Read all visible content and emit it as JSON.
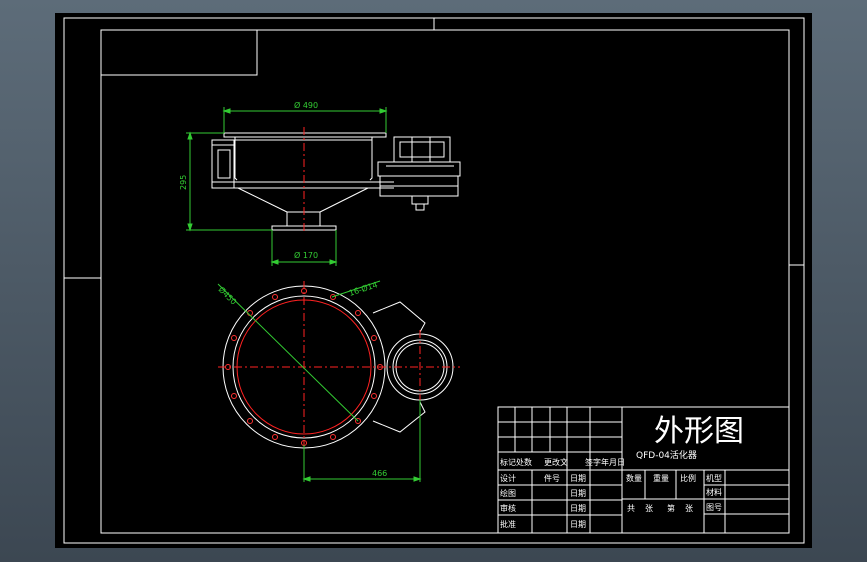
{
  "colors": {
    "background": "#000000",
    "frame": "#ffffff",
    "dimension": "#33cc33",
    "centerline": "#ff2222",
    "bolt_holes": "#ff3333",
    "viewport": "#4a5a68"
  },
  "drawing": {
    "front_view": {
      "dim_top_diameter": "Ø 490",
      "dim_height": "295",
      "dim_bottom_diameter": "Ø 170"
    },
    "top_view": {
      "dim_circle_diameter": "Ø450",
      "dim_holes": "16-Ø14",
      "dim_offset": "466"
    }
  },
  "title_block": {
    "title": "外形图",
    "product_code": "QFD-04活化器",
    "row_labels": {
      "mark_cells": "标记处数",
      "change_doc": "更改文",
      "sign_date": "签字年月日",
      "design": "设计",
      "part_no": "件号",
      "drawing": "绘图",
      "review": "审核",
      "approve": "批准",
      "date": "日期"
    },
    "info_labels": {
      "quantity": "数量",
      "weight": "重量",
      "scale": "比例",
      "model": "机型",
      "material": "材料",
      "total": "共",
      "sheet": "张",
      "page": "第",
      "sheet2": "张",
      "figure": "图号"
    }
  }
}
